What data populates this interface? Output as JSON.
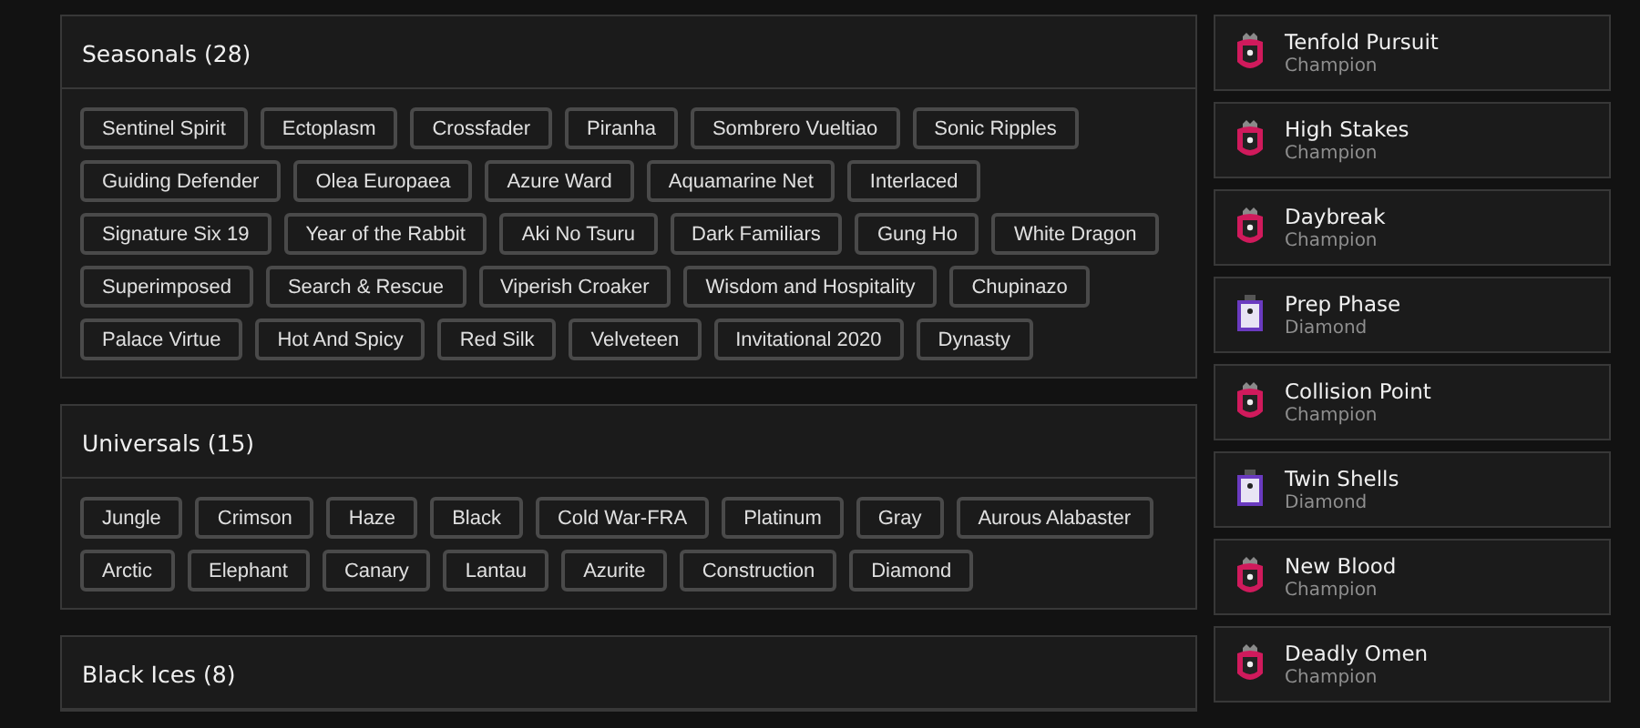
{
  "sections": [
    {
      "title": "Seasonals (28)",
      "tags": [
        "Sentinel Spirit",
        "Ectoplasm",
        "Crossfader",
        "Piranha",
        "Sombrero Vueltiao",
        "Sonic Ripples",
        "Guiding Defender",
        "Olea Europaea",
        "Azure Ward",
        "Aquamarine Net",
        "Interlaced",
        "Signature Six 19",
        "Year of the Rabbit",
        "Aki No Tsuru",
        "Dark Familiars",
        "Gung Ho",
        "White Dragon",
        "Superimposed",
        "Search & Rescue",
        "Viperish Croaker",
        "Wisdom and Hospitality",
        "Chupinazo",
        "Palace Virtue",
        "Hot And Spicy",
        "Red Silk",
        "Velveteen",
        "Invitational 2020",
        "Dynasty"
      ]
    },
    {
      "title": "Universals (15)",
      "tags": [
        "Jungle",
        "Crimson",
        "Haze",
        "Black",
        "Cold War-FRA",
        "Platinum",
        "Gray",
        "Aurous Alabaster",
        "Arctic",
        "Elephant",
        "Canary",
        "Lantau",
        "Azurite",
        "Construction",
        "Diamond"
      ]
    },
    {
      "title": "Black Ices (8)"
    }
  ],
  "challenges": [
    {
      "name": "Tenfold Pursuit",
      "rank": "Champion",
      "kind": "champion"
    },
    {
      "name": "High Stakes",
      "rank": "Champion",
      "kind": "champion"
    },
    {
      "name": "Daybreak",
      "rank": "Champion",
      "kind": "champion"
    },
    {
      "name": "Prep Phase",
      "rank": "Diamond",
      "kind": "diamond"
    },
    {
      "name": "Collision Point",
      "rank": "Champion",
      "kind": "champion"
    },
    {
      "name": "Twin Shells",
      "rank": "Diamond",
      "kind": "diamond"
    },
    {
      "name": "New Blood",
      "rank": "Champion",
      "kind": "champion"
    },
    {
      "name": "Deadly Omen",
      "rank": "Champion",
      "kind": "champion"
    }
  ]
}
